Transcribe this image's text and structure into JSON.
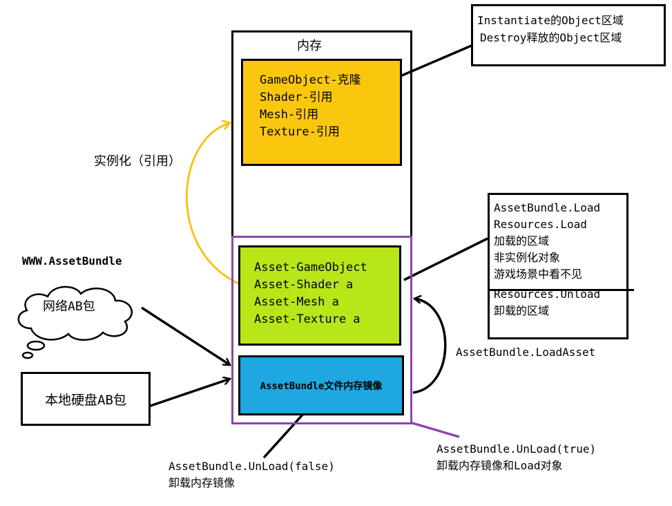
{
  "memory": {
    "title": "内存"
  },
  "instance_box": {
    "lines": [
      "GameObject-克隆",
      "Shader-引用",
      "Mesh-引用",
      "Texture-引用"
    ],
    "fill": "#f9c80e"
  },
  "asset_box": {
    "lines": [
      "Asset-GameObject",
      "Asset-Shader a",
      "Asset-Mesh a",
      "Asset-Texture a"
    ],
    "fill": "#b8e619"
  },
  "ab_mirror_box": {
    "label": "AssetBundle文件内存镜像",
    "fill": "#1ea7e0"
  },
  "instantiate_note": {
    "lines": [
      "Instantiate的Object区域",
      "Destroy释放的Object区域"
    ]
  },
  "load_note": {
    "lines": [
      "AssetBundle.Load",
      "Resources.Load",
      "加载的区域",
      "非实例化对象",
      "游戏场景中看不见"
    ],
    "unload_lines": [
      "Resources.Unload",
      "卸载的区域"
    ]
  },
  "labels": {
    "instantiate": "实例化（引用）",
    "www": "WWW.AssetBundle",
    "network_ab": "网络AB包",
    "local_ab": "本地硬盘AB包",
    "load_asset": "AssetBundle.LoadAsset",
    "unload_false": "AssetBundle.UnLoad(false)",
    "unload_false_desc": "卸载内存镜像",
    "unload_true": "AssetBundle.UnLoad(true)",
    "unload_true_desc": "卸载内存镜像和Load对象"
  },
  "colors": {
    "purple": "#8e44ad",
    "yellow_arrow": "#f5c518"
  }
}
